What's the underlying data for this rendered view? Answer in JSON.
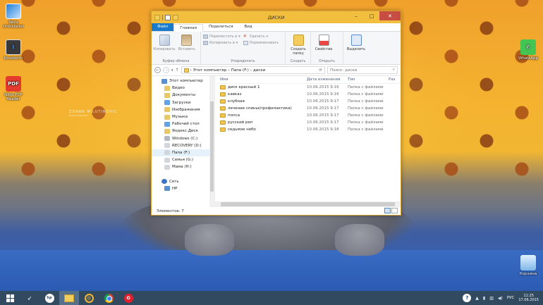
{
  "desktop": {
    "watermark": {
      "name": "ZORAN MILUTINOVIC",
      "sub": "PHOTOGRAPHY"
    },
    "icons": [
      {
        "label": "Revo Uninstaller",
        "icon": "revo-uninstaller-icon"
      },
      {
        "label": "bluetooth",
        "icon": "bluetooth-icon"
      },
      {
        "label": "Nitro PDF Reader",
        "icon": "pdf-reader-icon"
      },
      {
        "label": "WhatsApp",
        "icon": "whatsapp-icon"
      },
      {
        "label": "Корзина",
        "icon": "recycle-bin-icon"
      }
    ]
  },
  "window": {
    "title": "ДИСКИ",
    "tabs": {
      "file": "Файл",
      "home": "Главная",
      "share": "Поделиться",
      "view": "Вид"
    },
    "ribbon": {
      "copy": "Копировать",
      "paste": "Вставить",
      "clipboard_group": "Буфер обмена",
      "move_to": "Переместить в",
      "copy_to": "Копировать в",
      "delete": "Удалить",
      "rename": "Переименовать",
      "organize_group": "Упорядочить",
      "new_folder": "Создать папку",
      "create_group": "Создать",
      "properties": "Свойства",
      "open_group": "Открыть",
      "select": "Выделить"
    },
    "address": {
      "crumbs": [
        "Этот компьютер",
        "Папа (F:)",
        "диски"
      ],
      "search_placeholder": "Поиск: диски"
    },
    "nav": [
      {
        "label": "Этот компьютер",
        "icon": "pc"
      },
      {
        "label": "Видео",
        "icon": "fold"
      },
      {
        "label": "Документы",
        "icon": "fold"
      },
      {
        "label": "Загрузки",
        "icon": "blue"
      },
      {
        "label": "Изображения",
        "icon": "fold"
      },
      {
        "label": "Музыка",
        "icon": "fold"
      },
      {
        "label": "Рабочий стол",
        "icon": "blue"
      },
      {
        "label": "Яндекс.Диск",
        "icon": "fold"
      },
      {
        "label": "Windows (C:)",
        "icon": "drive"
      },
      {
        "label": "RECOVERY (D:)",
        "icon": "drive2"
      },
      {
        "label": "Папа (F:)",
        "icon": "drive2",
        "selected": true
      },
      {
        "label": "Семья (G:)",
        "icon": "drive2"
      },
      {
        "label": "Мама (H:)",
        "icon": "drive2"
      },
      {
        "label": "",
        "icon": "gap"
      },
      {
        "label": "Сеть",
        "icon": "net"
      },
      {
        "label": "HP",
        "icon": "pc"
      }
    ],
    "columns": {
      "name": "Имя",
      "date": "Дата изменения",
      "type": "Тип",
      "size": "Раз"
    },
    "files": [
      {
        "name": "диск красный 1",
        "date": "10.06.2015 9:16",
        "type": "Папка с файлами"
      },
      {
        "name": "кавказ",
        "date": "10.06.2015 9:16",
        "type": "Папка с файлами"
      },
      {
        "name": "клубная",
        "date": "10.06.2015 9:17",
        "type": "Папка с файлами"
      },
      {
        "name": "лечение спины(профилактика)",
        "date": "10.06.2015 9:17",
        "type": "Папка с файлами"
      },
      {
        "name": "попса",
        "date": "10.06.2015 9:17",
        "type": "Папка с файлами"
      },
      {
        "name": "русский реп",
        "date": "10.06.2015 9:17",
        "type": "Папка с файлами"
      },
      {
        "name": "седьмое небо",
        "date": "10.06.2015 9:18",
        "type": "Папка с файлами"
      }
    ],
    "status": "Элементов: 7"
  },
  "taskbar": {
    "apps": [
      "start",
      "launcher",
      "hp",
      "explorer",
      "mail",
      "chrome",
      "opera"
    ],
    "hp_label": "hp",
    "opera_label": "O",
    "mail_label": "@",
    "tray": {
      "lang": "РУС",
      "time": "11:25",
      "date": "17.06.2015",
      "help": "?"
    }
  },
  "colors": {
    "titlebar": "#f2be3e",
    "file_tab": "#1979ca",
    "taskbar": "#324a5f",
    "close": "#c74d43"
  }
}
